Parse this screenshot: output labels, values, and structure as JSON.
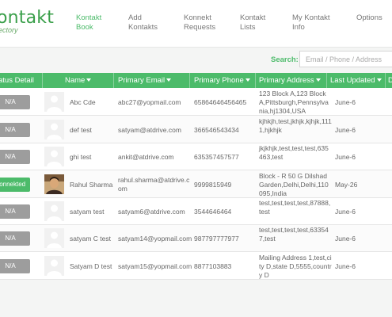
{
  "app": {
    "logo_title": "ontakt",
    "logo_title_prefix": "K",
    "logo_subtitle": "ectory"
  },
  "nav": [
    {
      "label_line1": "Kontakt",
      "label_line2": "Book",
      "active": true
    },
    {
      "label_line1": "Add",
      "label_line2": "Kontakts",
      "active": false
    },
    {
      "label_line1": "Konnekt",
      "label_line2": "Requests",
      "active": false
    },
    {
      "label_line1": "Kontakt",
      "label_line2": "Lists",
      "active": false
    },
    {
      "label_line1": "My Kontakt",
      "label_line2": "Info",
      "active": false
    },
    {
      "label_line1": "Options",
      "label_line2": "",
      "active": false
    }
  ],
  "search": {
    "label": "Search:",
    "placeholder": "Email / Phone / Address"
  },
  "table": {
    "headers": {
      "status": "atus Detail",
      "name": "Name",
      "email": "Primary Email",
      "phone": "Primary Phone",
      "address": "Primary Address",
      "updated": "Last Updated",
      "extra": "D"
    },
    "rows": [
      {
        "status": "N/A",
        "status_type": "na",
        "name": "Abc Cde",
        "email": "abc27@yopmail.com",
        "phone": "65864646456465",
        "address": "123 Block A,123 Block A,Pittsburgh,Pennsylvania,hj1304,USA",
        "updated": "June-6",
        "photo": false
      },
      {
        "status": "N/A",
        "status_type": "na",
        "name": "def test",
        "email": "satyam@atdrive.com",
        "phone": "366546543434",
        "address": "kjhkjh,test,jkhjk,kjhjk,1111,hjkhjk",
        "updated": "June-6",
        "photo": false
      },
      {
        "status": "N/A",
        "status_type": "na",
        "name": "ghi test",
        "email": "ankit@atdrive.com",
        "phone": "635357457577",
        "address": "jkjkhjk,test,test,test,635463,test",
        "updated": "June-6",
        "photo": false
      },
      {
        "status": "Konnekted",
        "status_type": "connected",
        "name": "Rahul Sharma",
        "email": "rahul.sharma@atdrive.com",
        "phone": "9999815949",
        "address": "Block - R 50 G Dilshad Garden,Delhi,Delhi,110095,India",
        "updated": "May-26",
        "photo": true
      },
      {
        "status": "N/A",
        "status_type": "na",
        "name": "satyam test",
        "email": "satyam6@atdrive.com",
        "phone": "3544646464",
        "address": "test,test,test,test,87888,test",
        "updated": "June-6",
        "photo": false
      },
      {
        "status": "N/A",
        "status_type": "na",
        "name": "satyam C test",
        "email": "satyam14@yopmail.com",
        "phone": "987797777977",
        "address": "test,test,test,test,633547,test",
        "updated": "June-6",
        "photo": false
      },
      {
        "status": "N/A",
        "status_type": "na",
        "name": "Satyam D test",
        "email": "satyam15@yopmail.com",
        "phone": "8877103883",
        "address": "Mailing Address 1,test,city D,state D,5555,country D",
        "updated": "June-6",
        "photo": false
      }
    ]
  },
  "colors": {
    "accent": "#4cbb6a",
    "badge_na": "#9d9d9d",
    "badge_connected": "#4cbb6a"
  },
  "icons": {
    "avatar_placeholder": "person-silhouette-icon",
    "sort": "caret-down-icon"
  }
}
